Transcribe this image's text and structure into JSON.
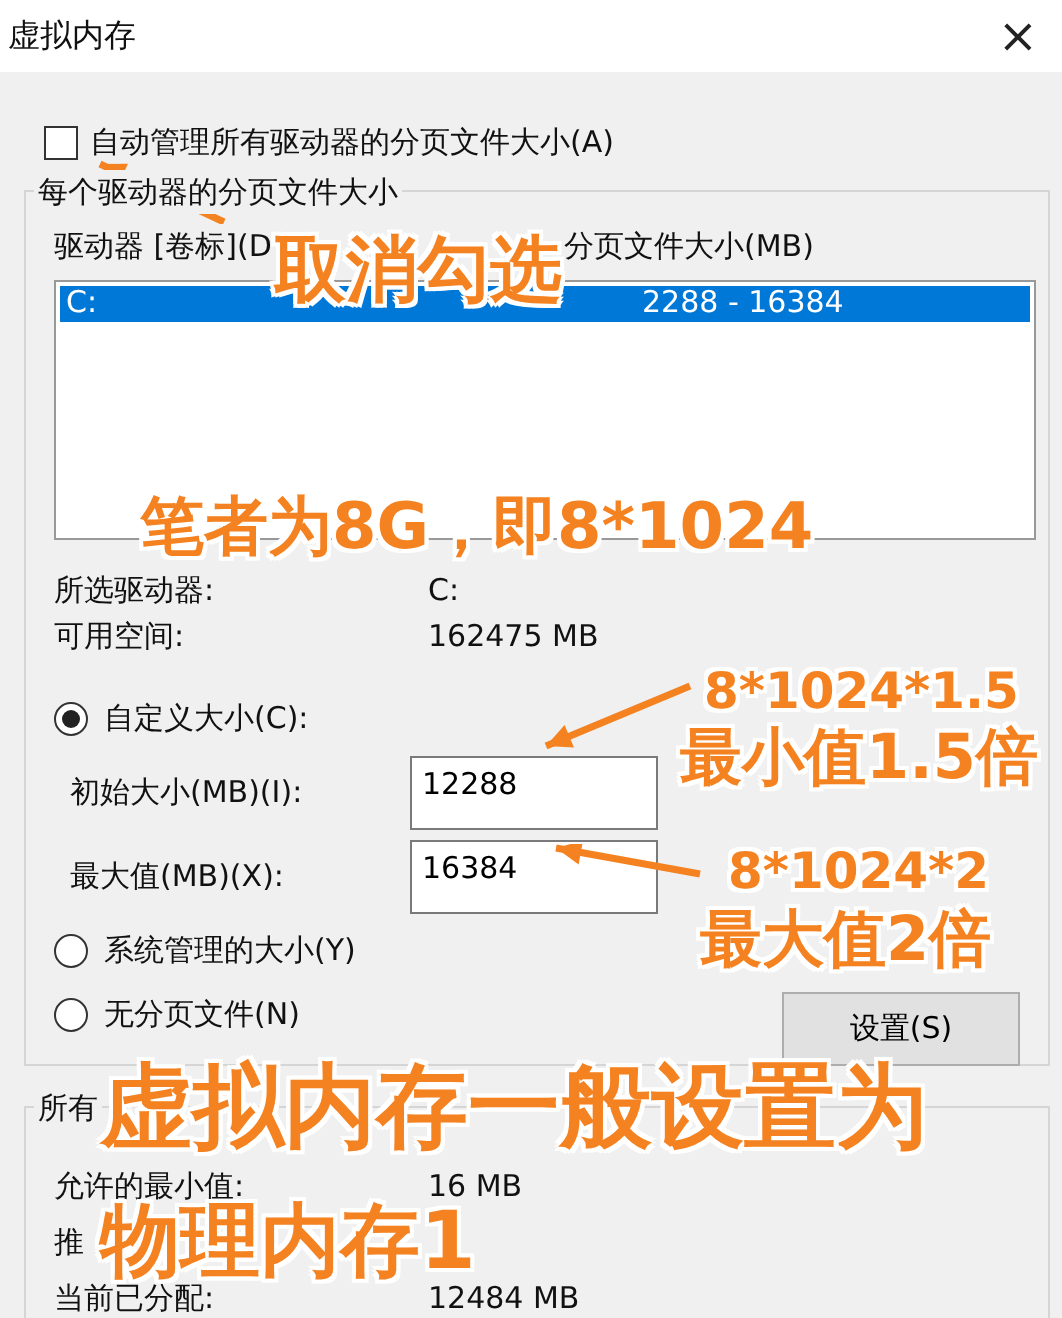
{
  "window": {
    "title": "虚拟内存",
    "close": "×"
  },
  "auto_manage": {
    "label": "自动管理所有驱动器的分页文件大小(A)",
    "checked": false
  },
  "per_drive": {
    "title": "每个驱动器的分页文件大小",
    "columns": [
      "驱动器 [卷标](D",
      "分页文件大小(MB)"
    ],
    "rows": [
      {
        "drive": "C:",
        "size": "2288 - 16384",
        "selected": true
      }
    ],
    "info": [
      {
        "label": "所选驱动器:",
        "value": "C:"
      },
      {
        "label": "可用空间:",
        "value": "162475 MB"
      }
    ],
    "options": [
      {
        "label": "自定义大小(C):",
        "selected": true,
        "fields": [
          {
            "label": "初始大小(MB)(I):",
            "value": "12288"
          },
          {
            "label": "最大值(MB)(X):",
            "value": "16384"
          }
        ]
      },
      {
        "label": "系统管理的大小(Y)",
        "selected": false
      },
      {
        "label": "无分页文件(N)",
        "selected": false
      }
    ],
    "set_button": "设置(S)"
  },
  "totals": {
    "title": "所有",
    "rows": [
      {
        "label": "允许的最小值:",
        "value": "16 MB"
      },
      {
        "label": "推"
      },
      {
        "label": "当前已分配:",
        "value": "12484 MB"
      }
    ]
  },
  "annotations": [
    {
      "text": "取消勾选"
    },
    {
      "text": "笔者为8G，即8*1024"
    },
    {
      "text": "8*1024*1.5"
    },
    {
      "text": "最小值1.5倍"
    },
    {
      "text": "8*1024*2"
    },
    {
      "text": "最大值2倍"
    },
    {
      "text": "虚拟内存一般设置为"
    },
    {
      "text": "物理内存1"
    }
  ]
}
